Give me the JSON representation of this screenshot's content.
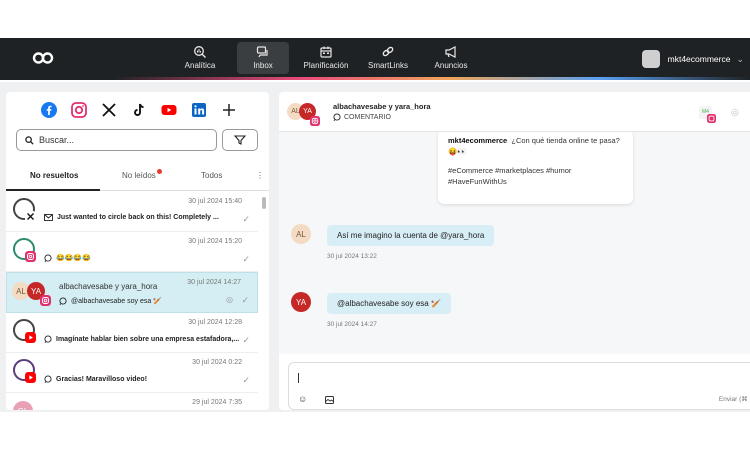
{
  "nav": {
    "items": [
      {
        "label": "Analítica",
        "icon": "analytics-icon"
      },
      {
        "label": "Inbox",
        "icon": "inbox-icon",
        "active": true
      },
      {
        "label": "Planificación",
        "icon": "calendar-icon"
      },
      {
        "label": "SmartLinks",
        "icon": "link-icon"
      },
      {
        "label": "Anuncios",
        "icon": "megaphone-icon"
      }
    ],
    "user": "mkt4ecommerce"
  },
  "inbox": {
    "search_placeholder": "Buscar...",
    "tabs": [
      "No resueltos",
      "No leídos",
      "Todos"
    ],
    "conversations": [
      {
        "date": "30 jul 2024 15:40",
        "message": "Just wanted to circle back on this! Completely ...",
        "kind": "email"
      },
      {
        "date": "30 jul 2024 15:20",
        "message": "😂😂😂😂",
        "kind": "comment"
      },
      {
        "date": "30 jul 2024 14:27",
        "name": "albachavesabe y yara_hora",
        "message": "@albachavesabe soy esa 🏏",
        "kind": "comment"
      },
      {
        "date": "30 jul 2024 12:28",
        "message": "Imagínate hablar bien sobre una empresa estafadora,...",
        "kind": "comment"
      },
      {
        "date": "30 jul 2024 0:22",
        "message": "Gracias! Maravilloso video!",
        "kind": "comment"
      },
      {
        "date": "29 jul 2024 7:35",
        "avatar_initials": "GL"
      }
    ]
  },
  "conversation": {
    "title": "albachavesabe y yara_hora",
    "subtitle": "COMENTARIO",
    "avatars": [
      "AL",
      "YA"
    ],
    "post": {
      "author": "mkt4ecommerce",
      "text": "¿Con qué tienda online te pasa? 😝👀",
      "tags": "#eCommerce #marketplaces #humor #HaveFunWithUs"
    },
    "messages": [
      {
        "avatar": "AL",
        "text": "Así me imagino la cuenta de @yara_hora",
        "time": "30 jul 2024 13:22"
      },
      {
        "avatar": "YA",
        "text": "@albachavesabe soy esa 🏏",
        "time": "30 jul 2024 14:27"
      }
    ],
    "composer_hint": "Enviar (⌘ + I"
  },
  "colors": {
    "accent": "#d4eef3",
    "topbar": "#1f2224",
    "instagram": "#e1306c",
    "youtube": "#ff0000",
    "facebook": "#1877f2",
    "linkedin": "#0a66c2"
  }
}
